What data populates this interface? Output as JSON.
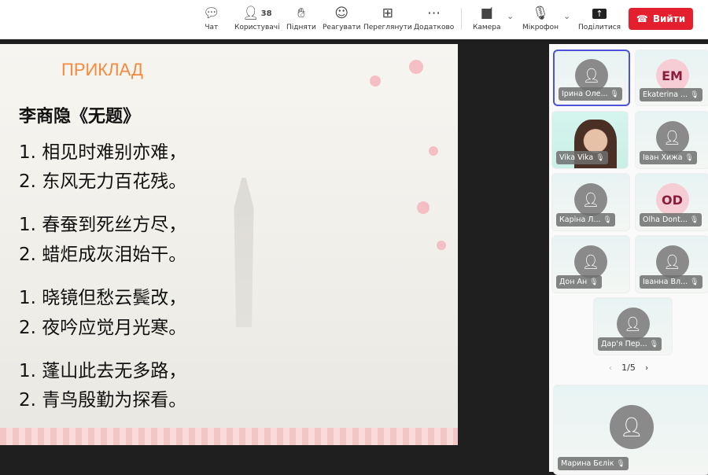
{
  "toolbar": {
    "chat": "Чат",
    "users": "Користувачі",
    "users_count": "38",
    "raise": "Підняти",
    "react": "Реагувати",
    "view": "Переглянути",
    "more": "Додатково",
    "camera": "Камера",
    "mic": "Мікрофон",
    "share": "Поділитися",
    "leave": "Вийти"
  },
  "slide": {
    "title": "ПРИКЛАД",
    "poem_title": "李商隐《无题》",
    "lines": [
      "1. 相见时难别亦难，",
      "2. 东风无力百花残。",
      "1. 春蚕到死丝方尽，",
      "2. 蜡炬成灰泪始干。",
      "1. 晓镜但愁云鬓改，",
      "2. 夜吟应觉月光寒。",
      "1. 蓬山此去无多路，",
      "2. 青鸟殷勤为探看。"
    ]
  },
  "participants": [
    {
      "name": "Ірина Оле...",
      "initials": ""
    },
    {
      "name": "Ekaterina ...",
      "initials": "EM"
    },
    {
      "name": "Vika Vika",
      "initials": ""
    },
    {
      "name": "Іван Хижа",
      "initials": ""
    },
    {
      "name": "Каріна Л...",
      "initials": ""
    },
    {
      "name": "Olha Dont...",
      "initials": "OD"
    },
    {
      "name": "Дон Ан",
      "initials": ""
    },
    {
      "name": "Іванна Вл...",
      "initials": ""
    },
    {
      "name": "Дар'я Пер...",
      "initials": ""
    },
    {
      "name": "Марина Бєлік",
      "initials": ""
    }
  ],
  "pager": {
    "label": "1/5"
  },
  "colors": {
    "accent": "#4f52d8",
    "leave": "#e4202e",
    "slide_title": "#f58a3e"
  }
}
